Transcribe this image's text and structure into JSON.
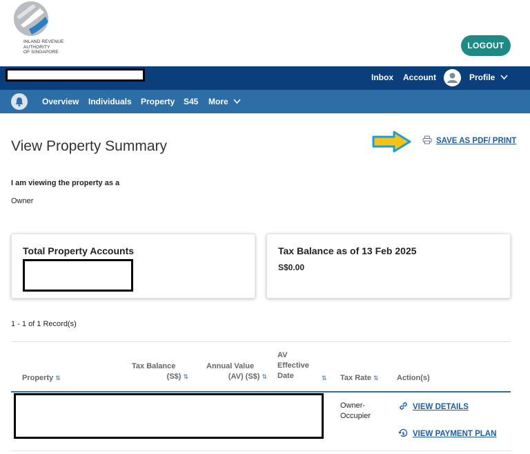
{
  "header": {
    "agency_name_lines": [
      "INLAND REVENUE",
      "AUTHORITY",
      "OF SINGAPORE"
    ],
    "logout_label": "LOGOUT"
  },
  "top_nav": {
    "inbox": "Inbox",
    "account": "Account",
    "profile": "Profile"
  },
  "sub_nav": {
    "items": [
      "Overview",
      "Individuals",
      "Property",
      "S45",
      "More"
    ]
  },
  "page": {
    "title": "View Property Summary",
    "print_label": "SAVE AS PDF/ PRINT",
    "viewing_label": "I am viewing the property as a",
    "viewing_value": "Owner"
  },
  "cards": {
    "total_accounts_title": "Total Property Accounts",
    "tax_balance_title": "Tax Balance as of 13 Feb 2025",
    "tax_balance_value": "S$0.00"
  },
  "table": {
    "record_count": "1 - 1 of 1 Record(s)",
    "headers": {
      "property": "Property",
      "tax_balance_line1": "Tax Balance",
      "tax_balance_line2": "(S$)",
      "annual_value_line1": "Annual Value",
      "annual_value_line2": "(AV) (S$)",
      "av_date_line1": "AV",
      "av_date_line2": "Effective",
      "av_date_line3": "Date",
      "tax_rate": "Tax Rate",
      "actions": "Action(s)"
    },
    "rows": [
      {
        "tax_rate_line1": "Owner-",
        "tax_rate_line2": "Occupier",
        "view_details": "VIEW DETAILS",
        "view_payment_plan": "VIEW PAYMENT PLAN"
      }
    ]
  },
  "colors": {
    "nav_primary": "#0b3f7b",
    "nav_secondary": "#2e6ea6",
    "logout_button": "#1d8a86",
    "link": "#1d5d9b",
    "annotation_arrow": "#f5c216"
  }
}
